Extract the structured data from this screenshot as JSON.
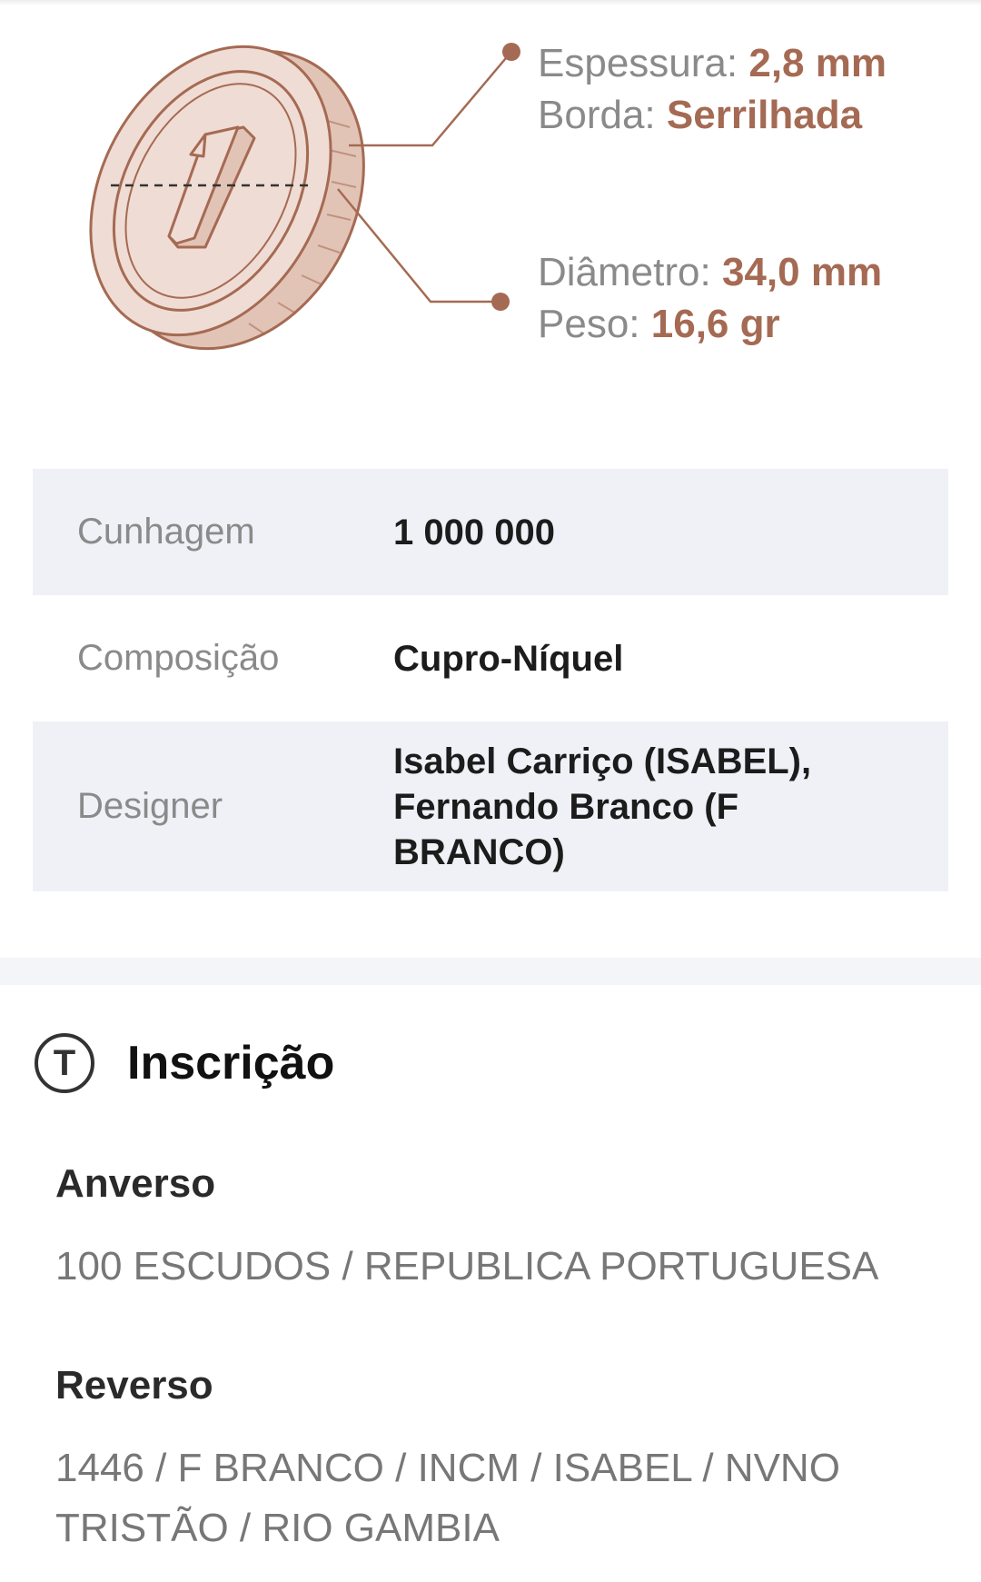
{
  "specs": {
    "thickness_label": "Espessura:",
    "thickness_value": "2,8 mm",
    "edge_label": "Borda:",
    "edge_value": "Serrilhada",
    "diameter_label": "Diâmetro:",
    "diameter_value": "34,0 mm",
    "weight_label": "Peso:",
    "weight_value": "16,6 gr"
  },
  "coin": {
    "numeral": "1",
    "face_color": "#efdcd4",
    "edge_color": "#e2c4b7",
    "line_color": "#a56a53"
  },
  "details": [
    {
      "label": "Cunhagem",
      "value": "1 000 000"
    },
    {
      "label": "Composição",
      "value": "Cupro-Níquel"
    },
    {
      "label": "Designer",
      "value": "Isabel Carriço (ISABEL), Fernando Branco (F BRANCO)"
    }
  ],
  "inscription": {
    "icon": "t-circle-icon",
    "icon_glyph": "T",
    "title": "Inscrição",
    "obverse_title": "Anverso",
    "obverse_text": "100 ESCUDOS / REPUBLICA PORTUGUESA",
    "reverse_title": "Reverso",
    "reverse_text": "1446 / F BRANCO / INCM / ISABEL / NVNO TRISTÃO / RIO GAMBIA"
  }
}
